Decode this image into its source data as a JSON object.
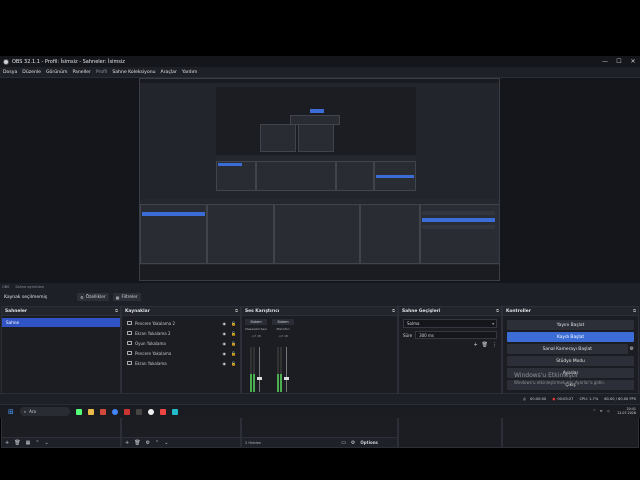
{
  "window": {
    "title": "OBS 32.1.1 - Profil: İsimsiz - Sahneler: İsimsiz",
    "controls": [
      "—",
      "☐",
      "✕"
    ]
  },
  "menu": {
    "items": [
      "Dosya",
      "Düzenle",
      "Görünüm",
      "Paneller",
      "Profil",
      "Sahne Koleksiyonu",
      "Araçlar",
      "Yardım"
    ]
  },
  "status_line": {
    "left": "OBS",
    "middle": "Sahne ayrıntıları"
  },
  "toolbar": {
    "label": "Kaynak seçilmemiş",
    "properties": "Özellikler",
    "filters": "Filtreler"
  },
  "scenes": {
    "title": "Sahneler",
    "items": [
      "Sahne"
    ]
  },
  "sources": {
    "title": "Kaynaklar",
    "items": [
      {
        "name": "Pencere Yakalama 2"
      },
      {
        "name": "Ekran Yakalama 2"
      },
      {
        "name": "Oyun Yakalama"
      },
      {
        "name": "Pencere Yakalama"
      },
      {
        "name": "Ekran Yakalama"
      }
    ]
  },
  "mixer": {
    "title": "Ses Karıştırıcı",
    "strips": [
      {
        "label": "Sistem",
        "device": "Masaüstü Sesi",
        "db": "-inf dB"
      },
      {
        "label": "Sistem",
        "device": "Mikrofon",
        "db": "-inf dB"
      }
    ],
    "hidden_note": "2 Hidden",
    "options": "Options"
  },
  "transitions": {
    "title": "Sahne Geçişleri",
    "type": "Solma",
    "duration_label": "Süre",
    "duration_value": "300 ms"
  },
  "controls": {
    "title": "Kontroller",
    "start_stream": "Yayını Başlat",
    "start_record": "Kaydı Başlat",
    "virtual_cam": "Sanal Kamerayı Başlat",
    "studio_mode": "Stüdyo Modu",
    "settings": "Ayarlar",
    "exit": "Çıkış"
  },
  "watermark": {
    "line1": "Windows'u Etkinleştir",
    "line2": "Windows'u etkinleştirmek için Ayarlar'a gidin."
  },
  "statusbar": {
    "rec_time": "00:00:00",
    "rec_time2": "00:03:27",
    "cpu": "CPU: 1.7%",
    "fps": "60.00 / 60.00 FPS"
  },
  "taskbar": {
    "search": "Ara",
    "time": "20:41",
    "date": "12.07.2026"
  },
  "colors": {
    "accent": "#3c6dd6",
    "panel": "#1b1d23",
    "background": "#1e2027"
  }
}
